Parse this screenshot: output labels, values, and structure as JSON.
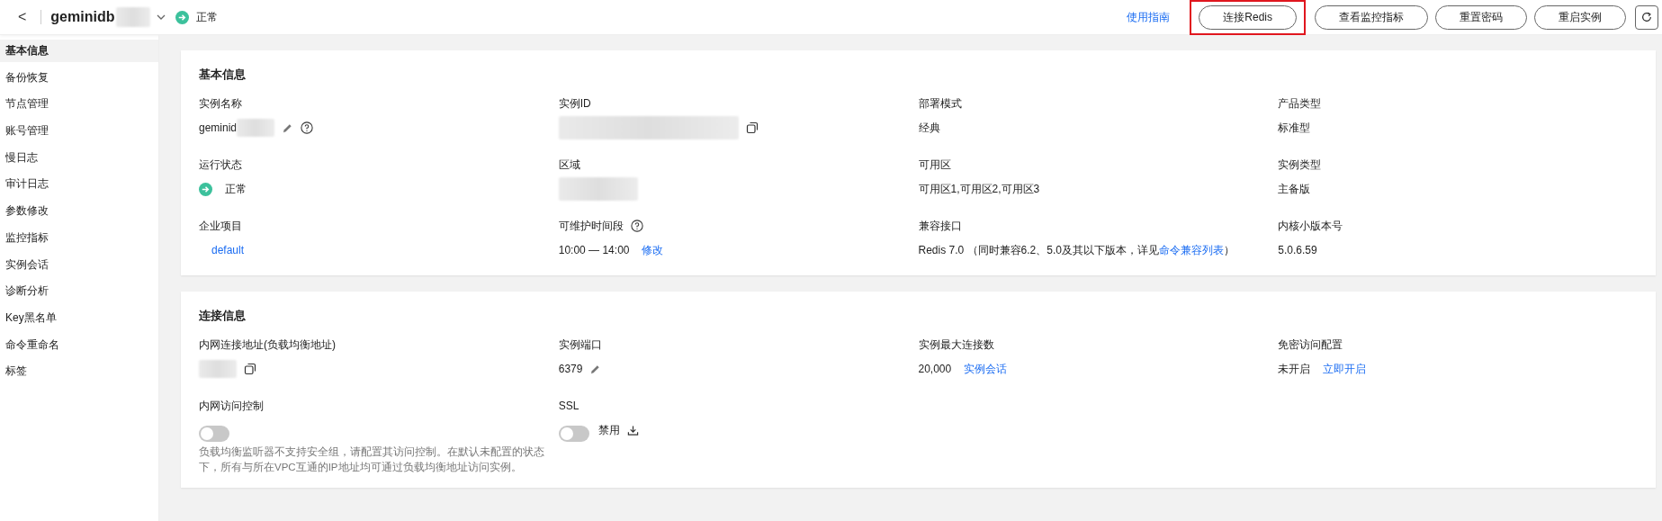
{
  "header": {
    "back_icon": "<",
    "title": "geminidb",
    "status": "正常",
    "guide_link": "使用指南",
    "buttons": [
      {
        "label": "连接Redis",
        "highlighted": true
      },
      {
        "label": "查看监控指标",
        "highlighted": false
      },
      {
        "label": "重置密码",
        "highlighted": false
      },
      {
        "label": "重启实例",
        "highlighted": false
      }
    ]
  },
  "sidebar": {
    "items": [
      {
        "label": "基本信息",
        "selected": true
      },
      {
        "label": "备份恢复",
        "selected": false
      },
      {
        "label": "节点管理",
        "selected": false
      },
      {
        "label": "账号管理",
        "selected": false
      },
      {
        "label": "慢日志",
        "selected": false
      },
      {
        "label": "审计日志",
        "selected": false
      },
      {
        "label": "参数修改",
        "selected": false
      },
      {
        "label": "监控指标",
        "selected": false
      },
      {
        "label": "实例会话",
        "selected": false
      },
      {
        "label": "诊断分析",
        "selected": false
      },
      {
        "label": "Key黑名单",
        "selected": false
      },
      {
        "label": "命令重命名",
        "selected": false
      },
      {
        "label": "标签",
        "selected": false
      }
    ]
  },
  "sections": [
    {
      "title": "基本信息",
      "fields": [
        {
          "label": "实例名称",
          "value": [
            {
              "kind": "text",
              "text": "geminid"
            },
            {
              "kind": "redacted"
            },
            {
              "kind": "edit"
            },
            {
              "kind": "help"
            }
          ]
        },
        {
          "label": "实例ID",
          "value": [
            {
              "kind": "redacted"
            },
            {
              "kind": "copy"
            }
          ]
        },
        {
          "label": "部署模式",
          "value": [
            {
              "kind": "text",
              "text": "经典"
            }
          ]
        },
        {
          "label": "产品类型",
          "value": [
            {
              "kind": "text",
              "text": "标准型"
            }
          ]
        },
        {
          "label": "运行状态",
          "value": [
            {
              "kind": "status",
              "text": "正常"
            }
          ]
        },
        {
          "label": "区域",
          "value": [
            {
              "kind": "redacted"
            }
          ]
        },
        {
          "label": "可用区",
          "value": [
            {
              "kind": "text",
              "text": "可用区1,可用区2,可用区3"
            }
          ]
        },
        {
          "label": "实例类型",
          "value": [
            {
              "kind": "text",
              "text": "主备版"
            }
          ]
        },
        {
          "label": "企业项目",
          "value": [
            {
              "kind": "link",
              "text": "default"
            }
          ]
        },
        {
          "label": "可维护时间段",
          "label_help": true,
          "value": [
            {
              "kind": "text",
              "text": "10:00 — 14:00"
            },
            {
              "kind": "link",
              "text": "修改"
            }
          ]
        },
        {
          "label": "兼容接口",
          "value": [
            {
              "kind": "sentence",
              "before": "Redis 7.0 （同时兼容6.2、5.0及其以下版本，详见",
              "link": "命令兼容列表",
              "after": "）"
            }
          ]
        },
        {
          "label": "内核小版本号",
          "value": [
            {
              "kind": "text",
              "text": "5.0.6.59"
            }
          ]
        }
      ]
    },
    {
      "title": "连接信息",
      "fields": [
        {
          "label": "内网连接地址(负载均衡地址)",
          "value": [
            {
              "kind": "redacted"
            },
            {
              "kind": "copy"
            }
          ]
        },
        {
          "label": "实例端口",
          "value": [
            {
              "kind": "text",
              "text": "6379"
            },
            {
              "kind": "edit"
            }
          ]
        },
        {
          "label": "实例最大连接数",
          "value": [
            {
              "kind": "text",
              "text": "20,000"
            },
            {
              "kind": "link",
              "text": "实例会话"
            }
          ]
        },
        {
          "label": "免密访问配置",
          "value": [
            {
              "kind": "text",
              "text": "未开启"
            },
            {
              "kind": "link",
              "text": "立即开启"
            }
          ]
        },
        {
          "label": "内网访问控制",
          "value": [
            {
              "kind": "toggle",
              "on": false
            }
          ],
          "note": "负载均衡监听器不支持安全组，请配置其访问控制。在默认未配置的状态下，所有与所在VPC互通的IP地址均可通过负载均衡地址访问实例。"
        },
        {
          "label": "SSL",
          "value": [
            {
              "kind": "toggle",
              "on": false
            },
            {
              "kind": "text",
              "text": "禁用"
            },
            {
              "kind": "download"
            }
          ]
        }
      ]
    }
  ]
}
